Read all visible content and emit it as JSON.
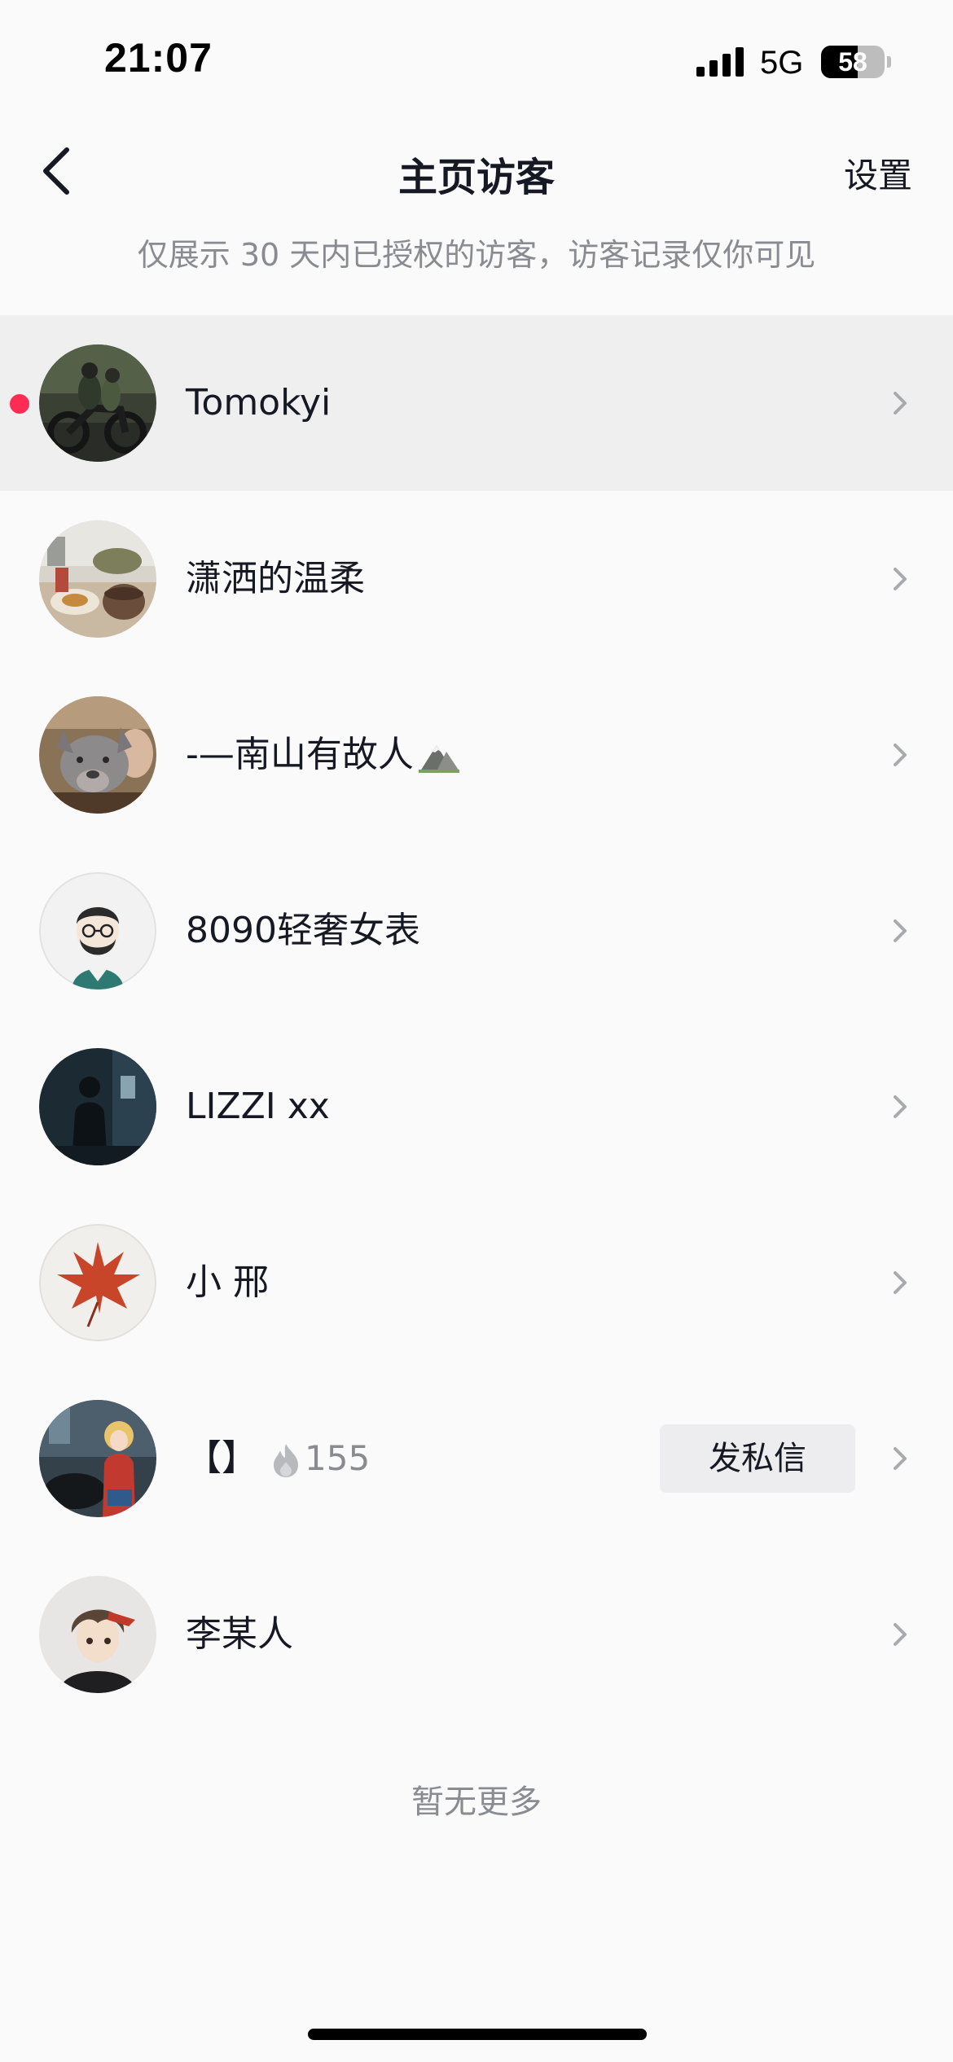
{
  "status_bar": {
    "time": "21:07",
    "network": "5G",
    "battery_level": "58",
    "battery_fraction": 0.58
  },
  "header": {
    "title": "主页访客",
    "settings_label": "设置"
  },
  "notice": "仅展示 30 天内已授权的访客，访客记录仅你可见",
  "visitors": [
    {
      "name": "Tomokyi",
      "unread": true,
      "highlighted": true,
      "avatar": "motorcycle-photo"
    },
    {
      "name": "潇洒的温柔",
      "avatar": "cafe-photo"
    },
    {
      "name": "-—南山有故人",
      "suffix_icon": "mountain-emoji-icon",
      "avatar": "dog-photo"
    },
    {
      "name": "8090轻奢女表",
      "avatar": "illustrated-man"
    },
    {
      "name": "LIZZI xx",
      "avatar": "dark-silhouette"
    },
    {
      "name": "小 邢",
      "avatar": "maple-leaf"
    },
    {
      "name": "【】",
      "streak_icon": "fire-icon",
      "streak_count": "155",
      "action_label": "发私信",
      "avatar": "anime-couple"
    },
    {
      "name": "李某人",
      "avatar": "anime-boy"
    }
  ],
  "footer_text": "暂无更多",
  "colors": {
    "unread_dot": "#fe2c55",
    "text_primary": "#161823",
    "text_secondary": "#8a8b91",
    "highlight_row": "#efeff0",
    "page_background": "#fafafa"
  }
}
